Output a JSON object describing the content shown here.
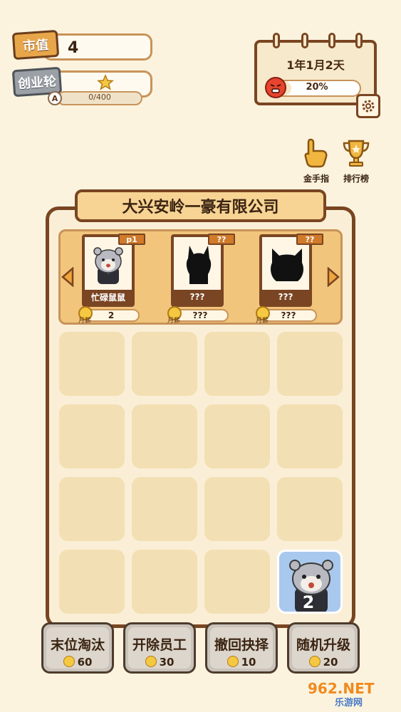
{
  "stats": {
    "market_value_label": "市值",
    "market_value": "4",
    "startup_round_label": "创业轮",
    "round_badge": "A",
    "round_progress": "0/400",
    "round_progress_fraction": 0
  },
  "calendar": {
    "date": "1年1月2天",
    "mood_percent": "20%",
    "mood_fraction": 0.2
  },
  "side_icons": {
    "golden_finger": "金手指",
    "leaderboard": "排行榜"
  },
  "company": {
    "name": "大兴安岭一豪有限公司"
  },
  "shelf_cards": [
    {
      "tag": "p1",
      "name": "忙碌鼠鼠",
      "salary": "2",
      "salary_label": "月薪"
    },
    {
      "tag": "??",
      "name": "???",
      "salary": "???",
      "salary_label": "月薪"
    },
    {
      "tag": "??",
      "name": "???",
      "salary": "???",
      "salary_label": "月薪"
    }
  ],
  "grid": {
    "occupied_tile_level": "2"
  },
  "actions": [
    {
      "label": "末位淘汰",
      "cost": "60"
    },
    {
      "label": "开除员工",
      "cost": "30"
    },
    {
      "label": "撤回抉择",
      "cost": "10"
    },
    {
      "label": "随机升级",
      "cost": "20"
    }
  ],
  "watermark": {
    "logo": "962.NET",
    "text": "乐游网"
  },
  "colors": {
    "background": "#fbf3de",
    "panel_border": "#7a4522",
    "accent_orange": "#e8a64a",
    "tile_blue": "#a9c8ee"
  }
}
